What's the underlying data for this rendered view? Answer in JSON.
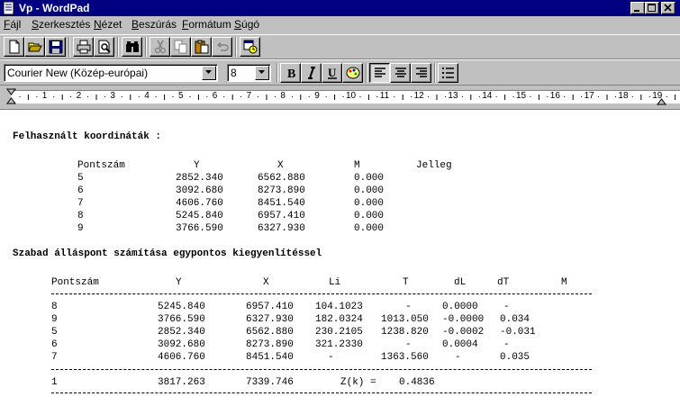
{
  "window": {
    "title": "Vp - WordPad"
  },
  "menu": [
    {
      "key": "F",
      "rest": "ájl"
    },
    {
      "key": "S",
      "rest": "zerkesztés"
    },
    {
      "key": "N",
      "rest": "ézet"
    },
    {
      "key": "B",
      "rest": "eszúrás"
    },
    {
      "key": "F",
      "rest": "ormátum"
    },
    {
      "key": "S",
      "rest": "úgó"
    }
  ],
  "format": {
    "font": "Courier New (Közép-európai)",
    "size": "8"
  },
  "ruler": {
    "numbers": [
      "1",
      "2",
      "3",
      "4",
      "5",
      "6",
      "7",
      "8",
      "9",
      "10",
      "11",
      "12",
      "13",
      "14",
      "15",
      "16",
      "17",
      "18",
      "19"
    ]
  },
  "document": {
    "heading1": "Felhasznált koordináták :",
    "table1": {
      "headers": [
        "Pontszám",
        "Y",
        "X",
        "M",
        "Jelleg"
      ],
      "rows": [
        [
          "5",
          "2852.340",
          "6562.880",
          "0.000"
        ],
        [
          "6",
          "3092.680",
          "8273.890",
          "0.000"
        ],
        [
          "7",
          "4606.760",
          "8451.540",
          "0.000"
        ],
        [
          "8",
          "5245.840",
          "6957.410",
          "0.000"
        ],
        [
          "9",
          "3766.590",
          "6327.930",
          "0.000"
        ]
      ]
    },
    "heading2": "Szabad álláspont számítása egypontos kiegyenlítéssel",
    "table2": {
      "headers": [
        "Pontszám",
        "Y",
        "X",
        "Li",
        "T",
        "dL",
        "dT",
        "M"
      ],
      "rows": [
        [
          "8",
          "5245.840",
          "6957.410",
          "104.1023",
          "-",
          "0.0000",
          "-"
        ],
        [
          "9",
          "3766.590",
          "6327.930",
          "182.0324",
          "1013.050",
          "-0.0000",
          "0.034"
        ],
        [
          "5",
          "2852.340",
          "6562.880",
          "230.2105",
          "1238.820",
          "-0.0002",
          "-0.031"
        ],
        [
          "6",
          "3092.680",
          "8273.890",
          "321.2330",
          "-",
          "0.0004",
          "-"
        ],
        [
          "7",
          "4606.760",
          "8451.540",
          "-",
          "1363.560",
          "-",
          "0.035"
        ]
      ],
      "result": {
        "pt": "1",
        "y": "3817.263",
        "x": "7339.746",
        "label": "Z(k) =",
        "value": "0.4836"
      }
    }
  }
}
